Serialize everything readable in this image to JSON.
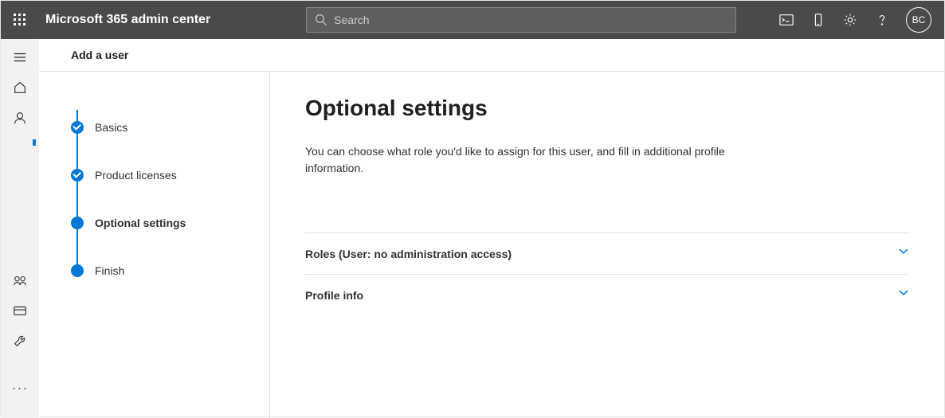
{
  "header": {
    "app_title": "Microsoft 365 admin center",
    "search_placeholder": "Search",
    "avatar_initials": "BC"
  },
  "panel": {
    "title": "Add a user"
  },
  "stepper": {
    "steps": [
      {
        "label": "Basics"
      },
      {
        "label": "Product licenses"
      },
      {
        "label": "Optional settings"
      },
      {
        "label": "Finish"
      }
    ]
  },
  "main": {
    "heading": "Optional settings",
    "subtitle": "You can choose what role you'd like to assign for this user, and fill in additional profile information.",
    "expanders": [
      {
        "label": "Roles (User: no administration access)"
      },
      {
        "label": "Profile info"
      }
    ]
  }
}
